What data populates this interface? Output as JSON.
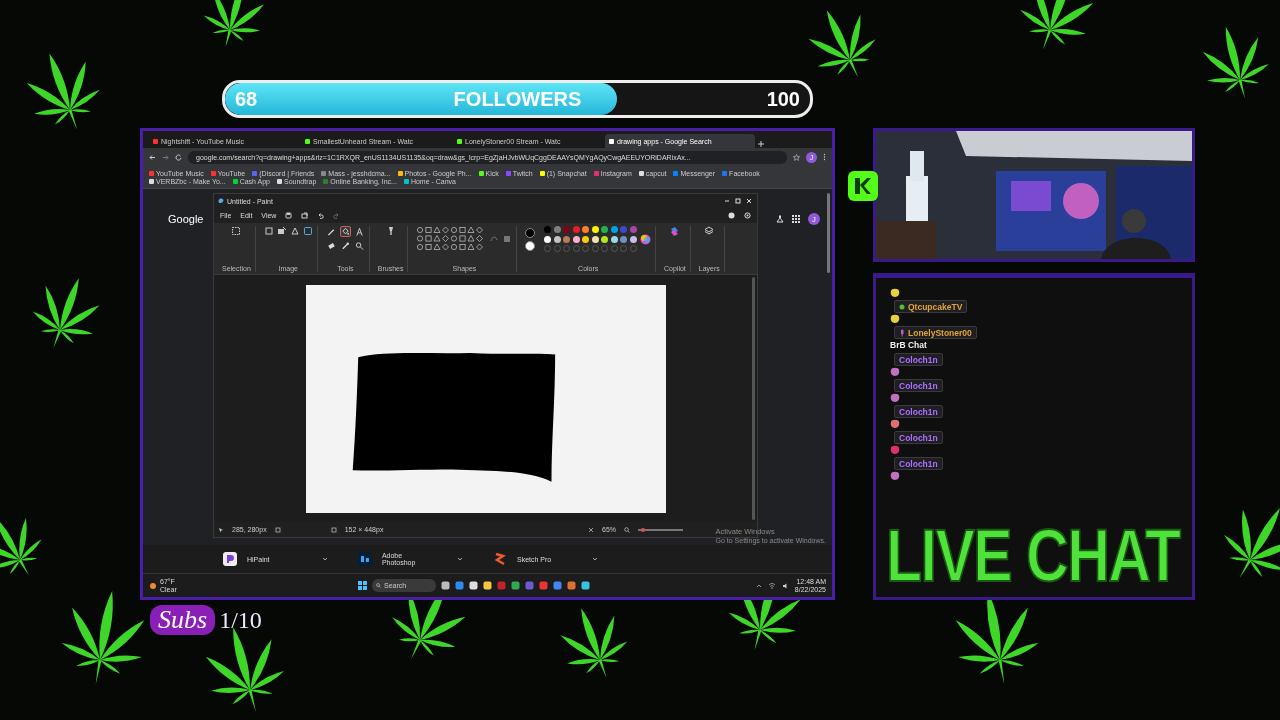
{
  "followers_goal": {
    "current": "68",
    "label": "FOLLOWERS",
    "goal": "100",
    "level": 0.67
  },
  "browser": {
    "tabs": [
      {
        "title": "Nightshift - YouTube Music",
        "selected": false
      },
      {
        "title": "SmallestUnheard Stream - Watc",
        "selected": false
      },
      {
        "title": "LonelyStoner00 Stream - Watc",
        "selected": false
      },
      {
        "title": "drawing apps - Google Search",
        "selected": true
      }
    ],
    "url": "google.com/search?q=drawing+apps&rlz=1C1RXQR_enUS1134US1135&oq=draw&gs_lcrp=EgZjaHJvbWUqCggDEAAYsQMYgAQyCwgAEEUYORiDARixAx...",
    "profile_initial": "J",
    "bookmarks": [
      "YouTube Music",
      "YouTube",
      "(Discord | Friends",
      "Mass - jesshdcma...",
      "Photos - Google Ph...",
      "Kick",
      "Twitch",
      "(1) Snapchat",
      "Instagram",
      "capcut",
      "Messenger",
      "Facebook",
      "VERBZbc - Make Yo...",
      "Cash App",
      "Soundtrap",
      "Online Banking, Inc...",
      "Home - Canva"
    ],
    "page_logo": "Google",
    "account_initial": "J"
  },
  "paint": {
    "title": "Untitled - Paint",
    "menu": [
      "File",
      "Edit",
      "View"
    ],
    "groups": [
      "Selection",
      "Image",
      "Tools",
      "Brushes",
      "Shapes",
      "Colors",
      "Copilot",
      "Layers"
    ],
    "tools": [
      {
        "kind": "pencil",
        "selected": false
      },
      {
        "kind": "fill",
        "selected": true
      },
      {
        "kind": "text",
        "selected": false
      },
      {
        "kind": "eraser",
        "selected": false
      },
      {
        "kind": "picker",
        "selected": false
      },
      {
        "kind": "magnifier",
        "selected": false
      }
    ],
    "active_colors": [
      {
        "color": "#000000"
      },
      {
        "color": "#ffffff"
      }
    ],
    "zoom_slider": {
      "level": 0.1
    },
    "palette": [
      {
        "color": "#000000"
      },
      {
        "color": "#7f7f7f"
      },
      {
        "color": "#880015"
      },
      {
        "color": "#ed1c24"
      },
      {
        "color": "#ff7f27"
      },
      {
        "color": "#fff200"
      },
      {
        "color": "#22b14c"
      },
      {
        "color": "#00a2e8"
      },
      {
        "color": "#3f48cc"
      },
      {
        "color": "#a349a4"
      },
      {
        "color": "#ffffff"
      },
      {
        "color": "#c3c3c3"
      },
      {
        "color": "#b97a57"
      },
      {
        "color": "#ffaec9"
      },
      {
        "color": "#ffc90e"
      },
      {
        "color": "#efe4b0"
      },
      {
        "color": "#b5e61d"
      },
      {
        "color": "#99d9ea"
      },
      {
        "color": "#7092be"
      },
      {
        "color": "#c8bfe7"
      }
    ],
    "cursor_position": "285, 280px",
    "canvas_size": "152 × 448px",
    "zoom": "65%"
  },
  "activation": {
    "title": "Activate Windows",
    "hint": "Go to Settings to activate Windows."
  },
  "suggested_apps": [
    "HiPaint",
    "Adobe Photoshop",
    "Sketch Pro"
  ],
  "taskbar": {
    "temperature": "67°F",
    "weather": "Clear",
    "search_placeholder": "Search",
    "time": "12:48 AM",
    "date": "8/22/2025"
  },
  "chat": {
    "messages": [
      {
        "kind": "emote"
      },
      {
        "kind": "emote",
        "user": "QtcupcakeTV",
        "color": "#e3a33a",
        "badge": {
          "kind": "dot"
        }
      },
      {
        "kind": "text",
        "user": "LonelyStoner00",
        "color": "#e3a33a",
        "badge": {
          "kind": "mic"
        },
        "text": "BrB Chat"
      },
      {
        "kind": "emote",
        "user": "Coloch1n",
        "color": "#a970ff"
      },
      {
        "kind": "emote",
        "user": "Coloch1n",
        "color": "#a970ff"
      },
      {
        "kind": "emote",
        "user": "Coloch1n",
        "color": "#a970ff"
      },
      {
        "kind": "emote",
        "user": "Coloch1n",
        "color": "#a970ff"
      },
      {
        "kind": "emote",
        "user": "Coloch1n",
        "color": "#a970ff"
      }
    ]
  },
  "live_chat_title": "LIVE CHAT",
  "subs": {
    "label": "Subs",
    "count": "1/10"
  }
}
